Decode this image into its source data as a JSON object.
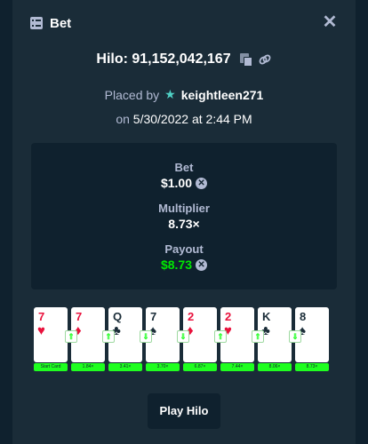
{
  "header": {
    "title": "Bet"
  },
  "game": {
    "line": "Hilo: 91,152,042,167"
  },
  "placed": {
    "prefix": "Placed by",
    "user": "keightleen271"
  },
  "date": {
    "prefix": "on",
    "value": "5/30/2022 at 2:44 PM"
  },
  "bet": {
    "label": "Bet",
    "value": "$1.00"
  },
  "multiplier": {
    "label": "Multiplier",
    "value": "8.73×"
  },
  "payout": {
    "label": "Payout",
    "value": "$8.73"
  },
  "cards": [
    {
      "rank": "7",
      "suit": "♥",
      "color": "red",
      "multiplier": "Start Card",
      "guess": ""
    },
    {
      "rank": "7",
      "suit": "♦",
      "color": "red",
      "multiplier": "1.84×",
      "guess": "up"
    },
    {
      "rank": "Q",
      "suit": "♣",
      "color": "black",
      "multiplier": "3.41×",
      "guess": "up"
    },
    {
      "rank": "7",
      "suit": "♠",
      "color": "black",
      "multiplier": "3.70×",
      "guess": "down"
    },
    {
      "rank": "2",
      "suit": "♦",
      "color": "red",
      "multiplier": "6.87×",
      "guess": "down"
    },
    {
      "rank": "2",
      "suit": "♥",
      "color": "red",
      "multiplier": "7.44×",
      "guess": "up"
    },
    {
      "rank": "K",
      "suit": "♣",
      "color": "black",
      "multiplier": "8.06×",
      "guess": "up"
    },
    {
      "rank": "8",
      "suit": "♠",
      "color": "black",
      "multiplier": "8.73×",
      "guess": "down"
    }
  ],
  "play_button": {
    "label": "Play Hilo"
  },
  "colors": {
    "accent_green": "#00e701",
    "background": "#0f212e",
    "panel": "#1a2c38"
  }
}
